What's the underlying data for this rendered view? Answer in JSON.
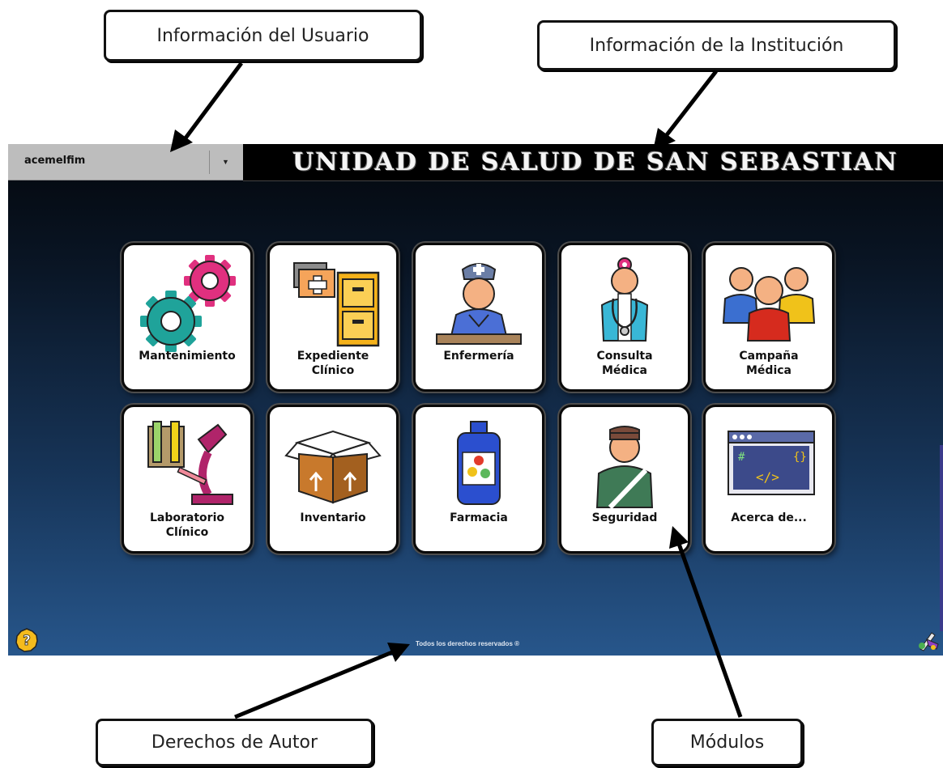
{
  "callouts": {
    "user_info": "Información del Usuario",
    "institution_info": "Información de la Institución",
    "copyright": "Derechos de Autor",
    "modules": "Módulos"
  },
  "app": {
    "user": {
      "name": "acemelfim",
      "caret_icon": "chevron-down-icon"
    },
    "institution_title": "UNIDAD DE SALUD DE SAN SEBASTIAN",
    "footer": {
      "copyright": "Todos los derechos reservados ®",
      "help_icon": "help-icon",
      "settings_icon": "paint-tools-icon"
    },
    "modules": [
      {
        "label": "Mantenimiento",
        "icon": "gears-icon"
      },
      {
        "label": "Expediente Clínico",
        "icon": "filing-cabinet-icon"
      },
      {
        "label": "Enfermería",
        "icon": "nurse-icon"
      },
      {
        "label": "Consulta Médica",
        "icon": "doctor-icon"
      },
      {
        "label": "Campaña Médica",
        "icon": "people-group-icon"
      },
      {
        "label": "Laboratorio Clínico",
        "icon": "microscope-icon"
      },
      {
        "label": "Inventario",
        "icon": "box-icon"
      },
      {
        "label": "Farmacia",
        "icon": "medicine-bottle-icon"
      },
      {
        "label": "Seguridad",
        "icon": "security-guard-icon"
      },
      {
        "label": "Acerca de...",
        "icon": "code-window-icon"
      }
    ]
  }
}
